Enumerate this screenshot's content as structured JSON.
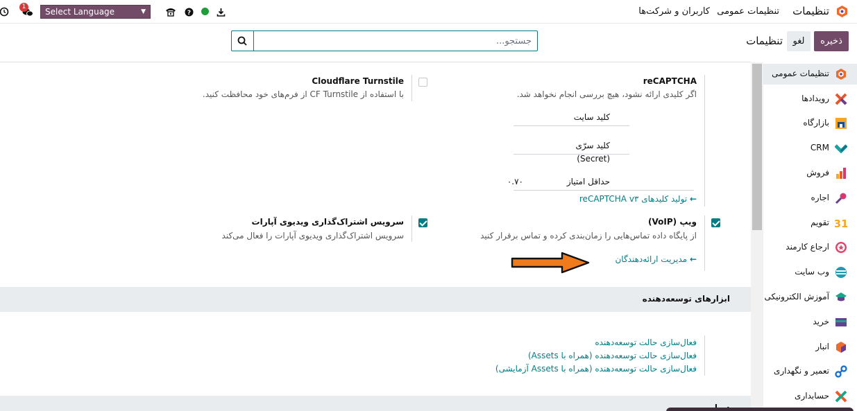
{
  "topbar": {
    "notification_count": "1",
    "language_select": "Select Language",
    "app_title": "تنظیمات",
    "menu": [
      "تنظیمات عمومی",
      "کاربران و شرکت‌ها"
    ]
  },
  "control_panel": {
    "save_label": "ذخیره",
    "cancel_label": "لغو",
    "breadcrumb": "تنظیمات",
    "search_placeholder": "جستجو..."
  },
  "integrations": {
    "recaptcha": {
      "title": "reCAPTCHA",
      "description": "اگر کلیدی ارائه نشود، هیچ بررسی انجام نخواهد شد.",
      "site_key_label": "کلید سایت",
      "site_key_value": "",
      "secret_key_label_1": "کلید سرّی",
      "secret_key_label_2": "(Secret)",
      "secret_key_value": "",
      "min_score_label": "حداقل امتیاز",
      "min_score_value": "۰.۷۰",
      "generate_link": "تولید کلیدهای reCAPTCHA v۳",
      "checked": false
    },
    "turnstile": {
      "title": "Cloudflare Turnstile",
      "description": "با استفاده از CF Turnstile از فرم‌های خود محافظت کنید.",
      "checked": false
    },
    "voip": {
      "title": "ویپ (VoIP)",
      "description": "از پایگاه داده تماس‌هایی را زمان‌بندی کرده و تماس برقرار کنید",
      "providers_link": "مدیریت ارائه‌دهندگان",
      "checked": true
    },
    "aparat": {
      "title": "سرویس اشتراک‌گذاری ویدیوی آپارات",
      "description": "سرویس اشتراک‌گذاری ویدیوی آپارات را فعال می‌کند",
      "checked": true
    }
  },
  "developer_tools": {
    "title": "ابزارهای توسعه‌دهنده",
    "links": [
      "فعال‌سازی حالت توسعه‌دهنده",
      "فعال‌سازی حالت توسعه‌دهنده (همراه با Assets)",
      "فعال‌سازی حالت توسعه‌دهنده (همراه با Assets آزمایشی)"
    ]
  },
  "next_section_title": "درباره",
  "sidebar": {
    "items": [
      {
        "label": "تنظیمات عمومی",
        "icon": "settings-app-icon",
        "color": "#f06a2a",
        "active": true
      },
      {
        "label": "رویدادها",
        "icon": "events-app-icon",
        "color": "#e8542e"
      },
      {
        "label": "بازارگاه",
        "icon": "marketplace-app-icon",
        "color": "#f5a623"
      },
      {
        "label": "CRM",
        "icon": "crm-app-icon",
        "color": "#1aa3a3"
      },
      {
        "label": "فروش",
        "icon": "sales-app-icon",
        "color": "#f05a28"
      },
      {
        "label": "اجاره",
        "icon": "rental-app-icon",
        "color": "#d9386e"
      },
      {
        "label": "تقویم",
        "icon": "calendar-app-icon",
        "color": "#f5a623"
      },
      {
        "label": "ارجاع کارمند",
        "icon": "referral-app-icon",
        "color": "#e0456b"
      },
      {
        "label": "وب سایت",
        "icon": "website-app-icon",
        "color": "#1d9bb5"
      },
      {
        "label": "آموزش الکترونیکی",
        "icon": "elearning-app-icon",
        "color": "#18a589"
      },
      {
        "label": "خرید",
        "icon": "purchase-app-icon",
        "color": "#6a3f8f"
      },
      {
        "label": "انبار",
        "icon": "inventory-app-icon",
        "color": "#f06a2a"
      },
      {
        "label": "تعمیر و نگهداری",
        "icon": "maintenance-app-icon",
        "color": "#1a73c9"
      },
      {
        "label": "حسابداری",
        "icon": "accounting-app-icon",
        "color": "#f05a28"
      }
    ]
  },
  "colors": {
    "brand": "#714b67",
    "accent": "#017e84",
    "arrow": "#f07b1c"
  }
}
